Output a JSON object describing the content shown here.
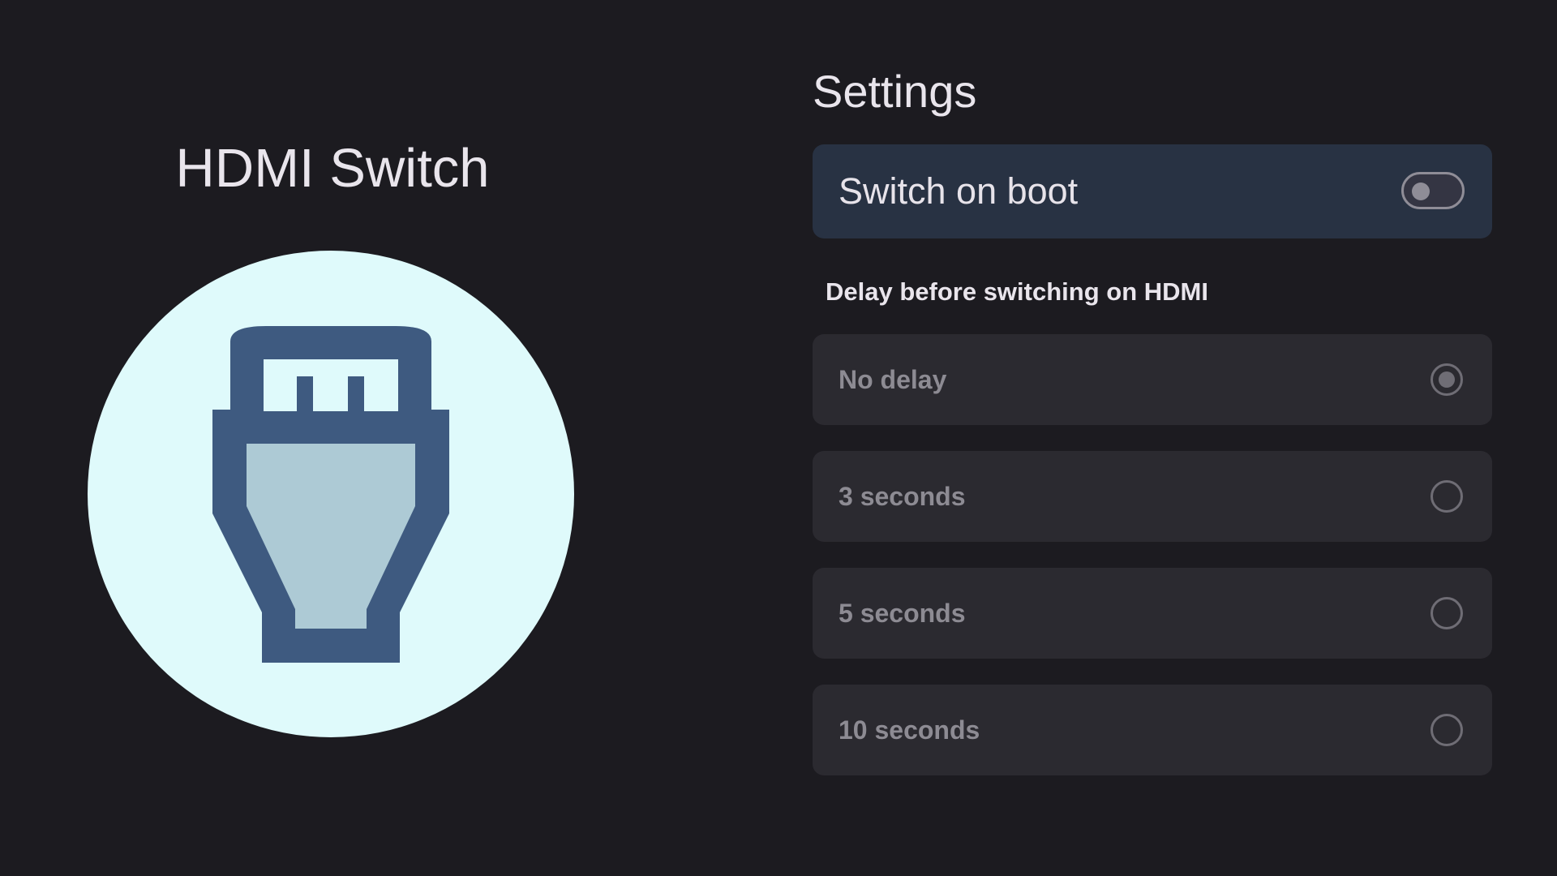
{
  "app": {
    "title": "HDMI Switch",
    "logo_icon": "hdmi-connector-icon"
  },
  "settings": {
    "heading": "Settings",
    "switch_on_boot": {
      "label": "Switch on boot",
      "enabled": false
    },
    "delay_section": {
      "label": "Delay before switching on HDMI",
      "options": [
        {
          "label": "No delay",
          "selected": true
        },
        {
          "label": "3 seconds",
          "selected": false
        },
        {
          "label": "5 seconds",
          "selected": false
        },
        {
          "label": "10 seconds",
          "selected": false
        }
      ]
    }
  },
  "colors": {
    "background": "#1c1b20",
    "logo_circle": "#dffafb",
    "connector_dark": "#3e5a80",
    "connector_light": "#adcad5",
    "toggle_card": "#283243",
    "option_card": "#2b2a30"
  }
}
